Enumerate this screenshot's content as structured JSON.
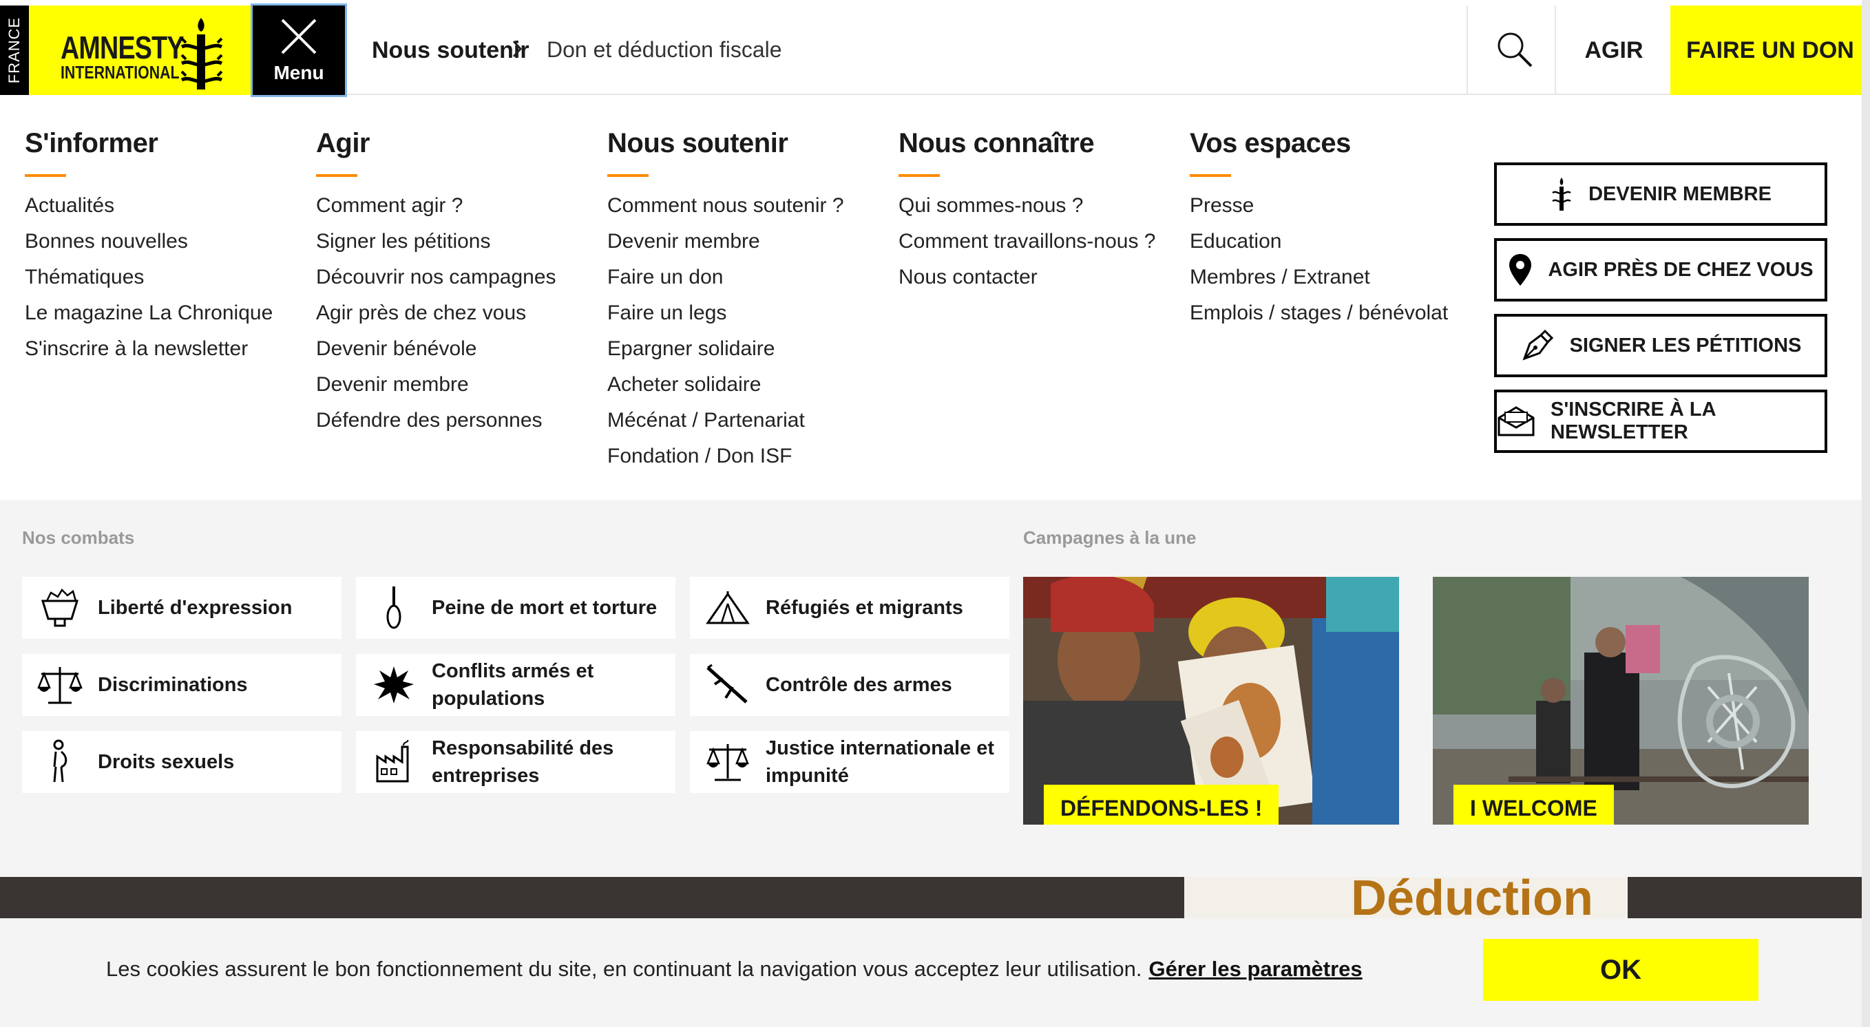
{
  "header": {
    "country": "FRANCE",
    "logo_line1": "AMNESTY",
    "logo_line2": "INTERNATIONAL",
    "menu_label": "Menu",
    "breadcrumb_parent": "Nous soutenir",
    "breadcrumb_current": "Don et déduction fiscale",
    "agir_label": "AGIR",
    "donate_label": "FAIRE UN DON",
    "colors": {
      "brand_yellow": "#ffff00",
      "accent_orange": "#ff8c00"
    }
  },
  "menu": {
    "columns": [
      {
        "title": "S'informer",
        "links": [
          "Actualités",
          "Bonnes nouvelles",
          "Thématiques",
          "Le magazine La Chronique",
          "S'inscrire à la newsletter"
        ]
      },
      {
        "title": "Agir",
        "links": [
          "Comment agir ?",
          "Signer les pétitions",
          "Découvrir nos campagnes",
          "Agir près de chez vous",
          "Devenir bénévole",
          "Devenir membre",
          "Défendre des personnes"
        ]
      },
      {
        "title": "Nous soutenir",
        "links": [
          "Comment nous soutenir ?",
          "Devenir membre",
          "Faire un don",
          "Faire un legs",
          "Epargner solidaire",
          "Acheter solidaire",
          "Mécénat / Partenariat",
          "Fondation / Don ISF"
        ]
      },
      {
        "title": "Nous connaître",
        "links": [
          "Qui sommes-nous ?",
          "Comment travaillons-nous ?",
          "Nous contacter"
        ]
      },
      {
        "title": "Vos espaces",
        "links": [
          "Presse",
          "Education",
          "Membres / Extranet",
          "Emplois / stages / bénévolat"
        ]
      }
    ],
    "side_buttons": [
      {
        "label": "DEVENIR MEMBRE",
        "icon": "candle-icon"
      },
      {
        "label": "AGIR PRÈS DE CHEZ VOUS",
        "icon": "location-pin-icon"
      },
      {
        "label": "SIGNER LES PÉTITIONS",
        "icon": "pen-nib-icon"
      },
      {
        "label": "S'INSCRIRE À LA NEWSLETTER",
        "icon": "envelope-icon"
      }
    ]
  },
  "combats": {
    "label": "Nos combats",
    "items": [
      {
        "label": "Liberté d'expression",
        "icon": "megaphone-icon"
      },
      {
        "label": "Peine de mort et torture",
        "icon": "noose-icon"
      },
      {
        "label": "Réfugiés et migrants",
        "icon": "tent-icon"
      },
      {
        "label": "Discriminations",
        "icon": "scale-icon"
      },
      {
        "label": "Conflits armés et populations",
        "icon": "explosion-icon"
      },
      {
        "label": "Contrôle des armes",
        "icon": "rifle-icon"
      },
      {
        "label": "Droits sexuels",
        "icon": "pregnant-woman-icon"
      },
      {
        "label": "Responsabilité des entreprises",
        "icon": "factory-icon"
      },
      {
        "label": "Justice internationale et impunité",
        "icon": "justice-scale-icon"
      }
    ]
  },
  "campaigns": {
    "label": "Campagnes à la une",
    "items": [
      {
        "tag": "DÉFENDONS-LES !"
      },
      {
        "tag": "I WELCOME"
      }
    ]
  },
  "background": {
    "partial_heading": "Déduction"
  },
  "cookie": {
    "text": "Les cookies assurent le bon fonctionnement du site, en continuant la navigation vous acceptez leur utilisation.",
    "link": "Gérer les paramètres",
    "ok": "OK"
  }
}
